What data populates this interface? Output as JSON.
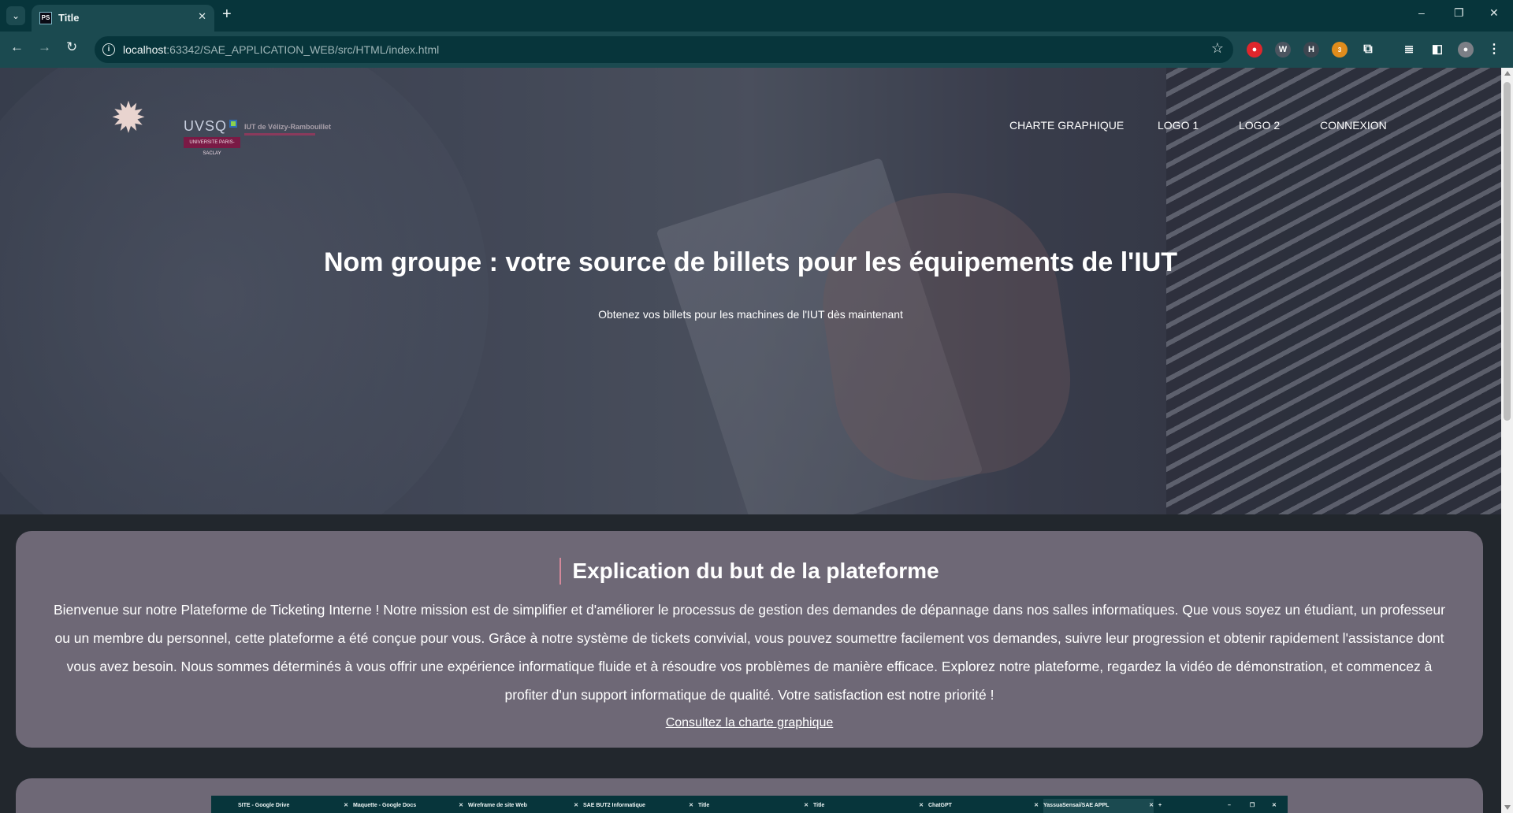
{
  "browser": {
    "tab_title": "Title",
    "tab_favicon": "PS",
    "url_host": "localhost",
    "url_rest": ":63342/SAE_APPLICATION_WEB/src/HTML/index.html",
    "icons": {
      "tab_search": "chevron-down-icon",
      "tab_close": "close-icon",
      "new_tab": "plus-icon",
      "back": "back-arrow-icon",
      "forward": "forward-arrow-icon",
      "reload": "reload-icon",
      "site_info": "info-icon",
      "bookmark": "star-icon",
      "extensions": "puzzle-icon",
      "side_panel": "side-panel-icon",
      "profile": "avatar-icon",
      "menu": "kebab-menu-icon"
    },
    "extension_badge": "3"
  },
  "header": {
    "logo": {
      "uvsq": "UVSQ",
      "iut": "IUT de Vélizy-Rambouillet",
      "university": "UNIVERSITE PARIS-SACLAY"
    },
    "nav": [
      {
        "label": "CHARTE GRAPHIQUE"
      },
      {
        "label": "LOGO 1"
      },
      {
        "label": "LOGO 2"
      },
      {
        "label": "CONNEXION"
      }
    ]
  },
  "hero": {
    "title": "Nom groupe : votre source de billets pour les équipements de l'IUT",
    "subtitle": "Obtenez vos billets pour les machines de l'IUT dès maintenant"
  },
  "about": {
    "title": "Explication du but de la plateforme",
    "text": "Bienvenue sur notre Plateforme de Ticketing Interne ! Notre mission est de simplifier et d'améliorer le processus de gestion des demandes de dépannage dans nos salles informatiques. Que vous soyez un étudiant, un professeur ou un membre du personnel, cette plateforme a été conçue pour vous. Grâce à notre système de tickets convivial, vous pouvez soumettre facilement vos demandes, suivre leur progression et obtenir rapidement l'assistance dont vous avez besoin. Nous sommes déterminés à vous offrir une expérience informatique fluide et à résoudre vos problèmes de manière efficace. Explorez notre plateforme, regardez la vidéo de démonstration, et commencez à profiter d'un support informatique de qualité. Votre satisfaction est notre priorité !",
    "link": "Consultez la charte graphique"
  },
  "demo_screenshot": {
    "tabs": [
      {
        "label": "SITE - Google Drive"
      },
      {
        "label": "Maquette - Google Docs"
      },
      {
        "label": "Wireframe de site Web"
      },
      {
        "label": "SAE BUT2 Informatique"
      },
      {
        "label": "Title"
      },
      {
        "label": "Title"
      },
      {
        "label": "ChatGPT"
      },
      {
        "label": "YassuaSensai/SAE APPL"
      }
    ]
  },
  "colors": {
    "chrome_dark": "#07353b",
    "chrome_toolbar": "#1b4a50",
    "card_bg": "#6e6876",
    "page_bg": "#22272d",
    "accent_bar": "#d4889a"
  }
}
